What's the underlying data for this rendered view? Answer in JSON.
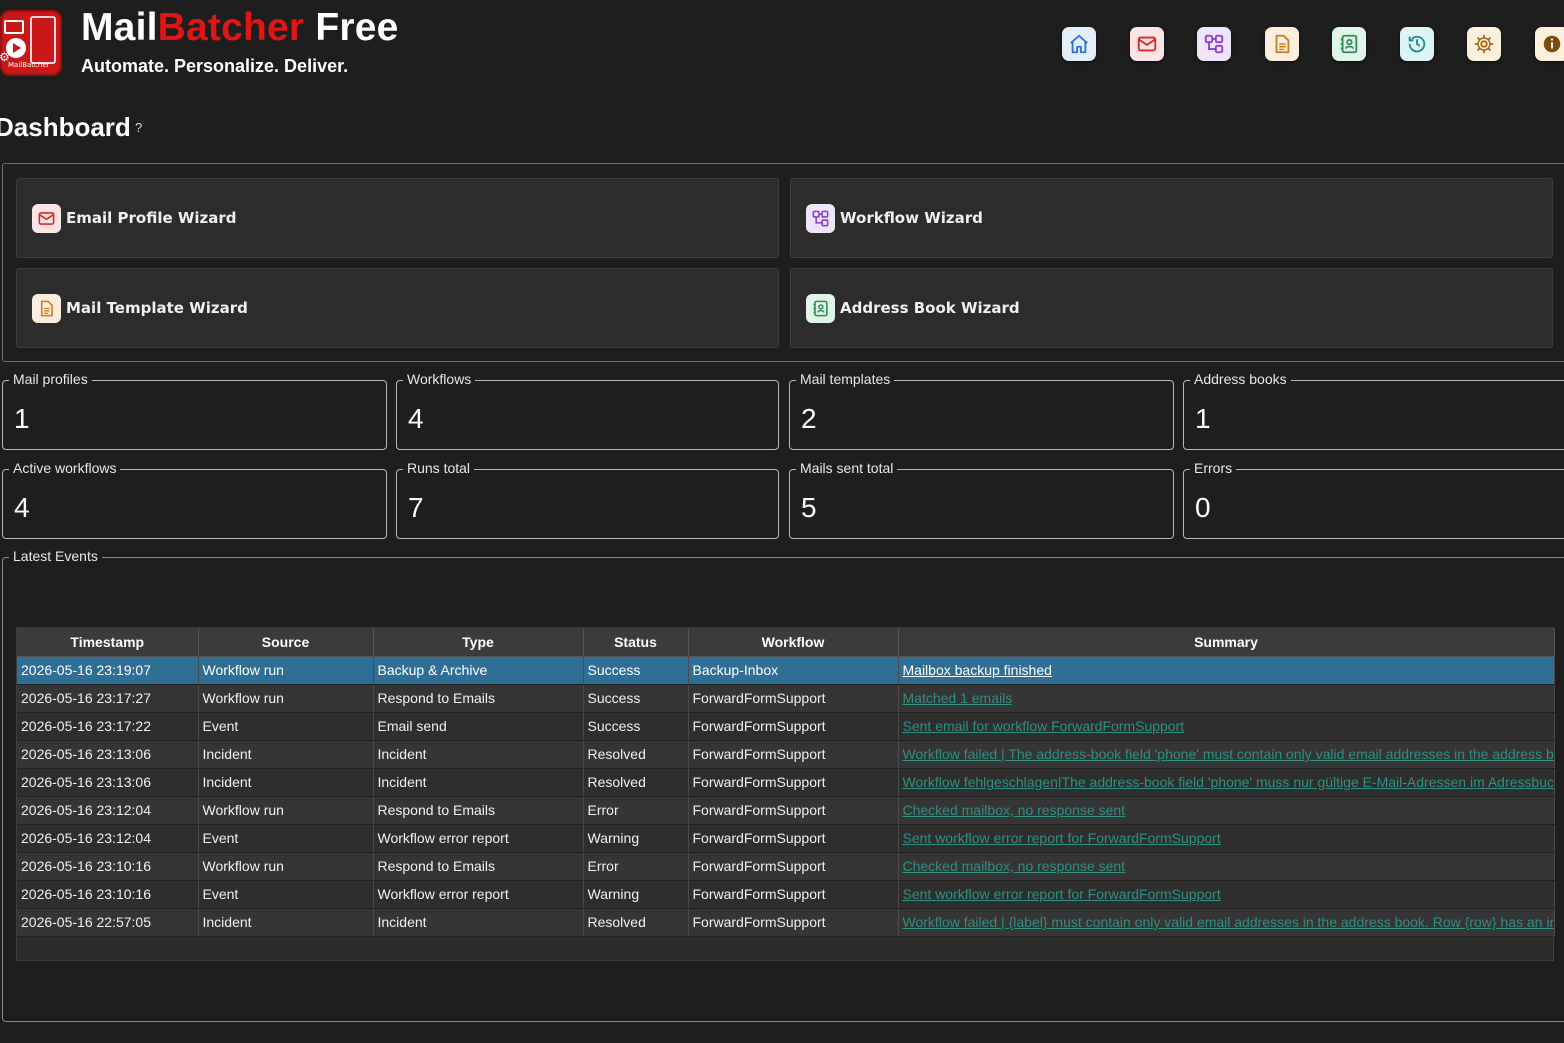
{
  "app": {
    "title_part1": "Mail",
    "title_part2": "Batcher",
    "title_part3": " Free",
    "tagline": "Automate. Personalize. Deliver.",
    "logo_text": "MailBatcher"
  },
  "nav": [
    {
      "icon": "home-icon",
      "color": "#2f6fd6",
      "bg": "#e4eefb"
    },
    {
      "icon": "mail-icon",
      "color": "#d62828",
      "bg": "#fbe4e4"
    },
    {
      "icon": "workflow-icon",
      "color": "#8a3fd0",
      "bg": "#efe4fb"
    },
    {
      "icon": "document-icon",
      "color": "#d07a1e",
      "bg": "#fbeede"
    },
    {
      "icon": "address-book-icon",
      "color": "#2e8a5a",
      "bg": "#def5e8"
    },
    {
      "icon": "history-icon",
      "color": "#1e8a8a",
      "bg": "#dcf4f4"
    },
    {
      "icon": "gear-icon",
      "color": "#a36a10",
      "bg": "#fbf0dc"
    },
    {
      "icon": "info-icon",
      "color": "#7a4a10",
      "bg": "#fbf0dc"
    }
  ],
  "page": {
    "title": "Dashboard",
    "help": "?"
  },
  "wizards": {
    "email_profile": "Email Profile Wizard",
    "workflow": "Workflow Wizard",
    "mail_template": "Mail Template Wizard",
    "address_book": "Address Book Wizard"
  },
  "stats": {
    "mail_profiles": {
      "label": "Mail profiles",
      "value": "1"
    },
    "workflows": {
      "label": "Workflows",
      "value": "4"
    },
    "mail_templates": {
      "label": "Mail templates",
      "value": "2"
    },
    "address_books": {
      "label": "Address books",
      "value": "1"
    },
    "active_workflows": {
      "label": "Active workflows",
      "value": "4"
    },
    "runs_total": {
      "label": "Runs total",
      "value": "7"
    },
    "mails_sent_total": {
      "label": "Mails sent total",
      "value": "5"
    },
    "errors": {
      "label": "Errors",
      "value": "0"
    }
  },
  "events": {
    "label": "Latest Events",
    "columns": [
      "Timestamp",
      "Source",
      "Type",
      "Status",
      "Workflow",
      "Summary"
    ],
    "rows": [
      [
        "2026-05-16 23:19:07",
        "Workflow run",
        "Backup & Archive",
        "Success",
        "Backup-Inbox",
        "Mailbox backup finished"
      ],
      [
        "2026-05-16 23:17:27",
        "Workflow run",
        "Respond to Emails",
        "Success",
        "ForwardFormSupport",
        "Matched 1 emails"
      ],
      [
        "2026-05-16 23:17:22",
        "Event",
        "Email send",
        "Success",
        "ForwardFormSupport",
        "Sent email for workflow ForwardFormSupport"
      ],
      [
        "2026-05-16 23:13:06",
        "Incident",
        "Incident",
        "Resolved",
        "ForwardFormSupport",
        "Workflow failed | The address-book field 'phone' must contain only valid email addresses in the address bo"
      ],
      [
        "2026-05-16 23:13:06",
        "Incident",
        "Incident",
        "Resolved",
        "ForwardFormSupport",
        "Workflow fehlgeschlagen|The address-book field 'phone' muss nur gültige E-Mail-Adressen im Adressbuch"
      ],
      [
        "2026-05-16 23:12:04",
        "Workflow run",
        "Respond to Emails",
        "Error",
        "ForwardFormSupport",
        "Checked mailbox, no response sent"
      ],
      [
        "2026-05-16 23:12:04",
        "Event",
        "Workflow error report",
        "Warning",
        "ForwardFormSupport",
        "Sent workflow error report for ForwardFormSupport"
      ],
      [
        "2026-05-16 23:10:16",
        "Workflow run",
        "Respond to Emails",
        "Error",
        "ForwardFormSupport",
        "Checked mailbox, no response sent"
      ],
      [
        "2026-05-16 23:10:16",
        "Event",
        "Workflow error report",
        "Warning",
        "ForwardFormSupport",
        "Sent workflow error report for ForwardFormSupport"
      ],
      [
        "2026-05-16 22:57:05",
        "Incident",
        "Incident",
        "Resolved",
        "ForwardFormSupport",
        "Workflow failed | {label} must contain only valid email addresses in the address book. Row {row} has an inv"
      ]
    ]
  }
}
